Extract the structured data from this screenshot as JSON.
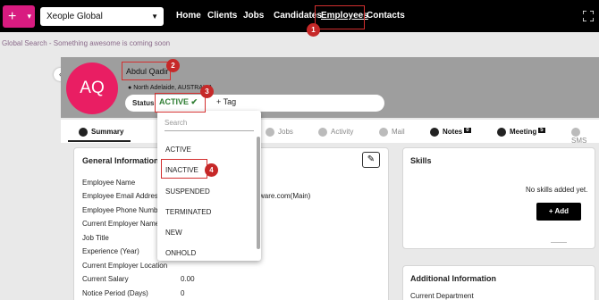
{
  "topbar": {
    "add_label": "+",
    "org_select": "Xeople Global",
    "nav": [
      "Home",
      "Clients",
      "Jobs",
      "Candidates",
      "Employees",
      "Contacts"
    ]
  },
  "global_search": "Global Search - Something awesome is coming soon",
  "profile": {
    "initials": "AQ",
    "name": "Abdul Qadir",
    "location": "North Adelaide, AUSTRALIA",
    "status_label": "Status",
    "status_value": "ACTIVE",
    "tag_label": "Tag"
  },
  "tabs": [
    {
      "label": "Summary",
      "badge": ""
    },
    {
      "label": "Jobs",
      "badge": ""
    },
    {
      "label": "Activity",
      "badge": ""
    },
    {
      "label": "Mail",
      "badge": ""
    },
    {
      "label": "Notes",
      "badge": "0"
    },
    {
      "label": "Meeting",
      "badge": "5"
    },
    {
      "label": "SMS",
      "badge": ""
    }
  ],
  "general_info": {
    "title": "General Information",
    "fields": [
      {
        "label": "Employee Name",
        "value": ""
      },
      {
        "label": "Employee Email Address",
        "value": "ware.com(Main)"
      },
      {
        "label": "Employee Phone Number",
        "value": ""
      },
      {
        "label": "Current Employer Name",
        "value": ""
      },
      {
        "label": "Job Title",
        "value": ""
      },
      {
        "label": "Experience (Year)",
        "value": ""
      },
      {
        "label": "Current Employer Location",
        "value": ""
      },
      {
        "label": "Current Salary",
        "value": "0.00"
      },
      {
        "label": "Notice Period (Days)",
        "value": "0"
      }
    ]
  },
  "skills": {
    "title": "Skills",
    "empty_text": "No skills added yet.",
    "add_label": "Add"
  },
  "additional_info": {
    "title": "Additional Information",
    "first_field": "Current Department"
  },
  "status_dropdown": {
    "search_placeholder": "Search",
    "options": [
      "ACTIVE",
      "INACTIVE",
      "SUSPENDED",
      "TERMINATED",
      "NEW",
      "ONHOLD"
    ]
  },
  "callouts": [
    "1",
    "2",
    "3",
    "4"
  ],
  "colors": {
    "brand_pink": "#e91e63",
    "callout_red": "#c62828",
    "status_green": "#2e7d32"
  }
}
